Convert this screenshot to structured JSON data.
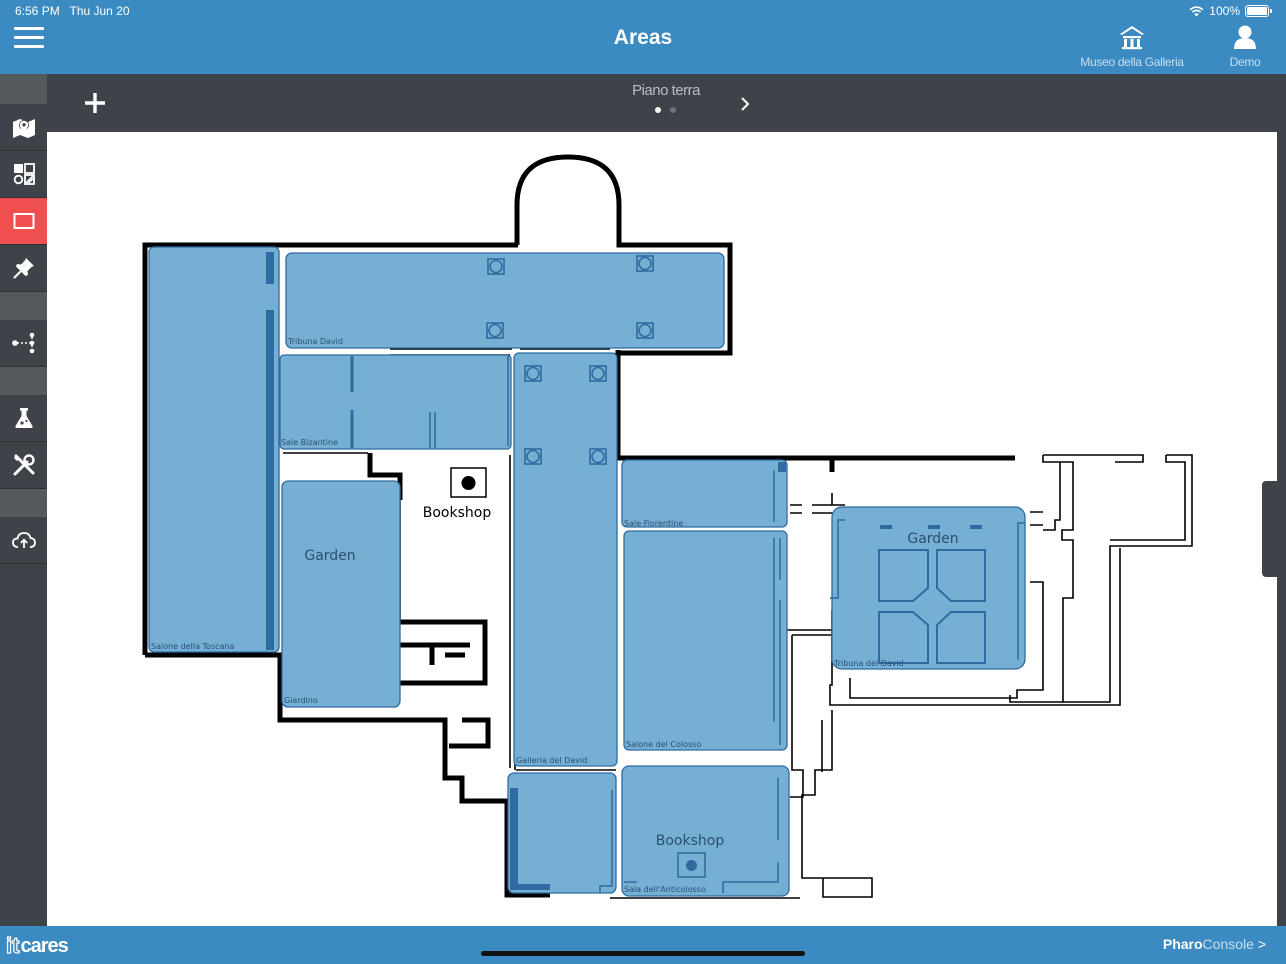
{
  "status_bar": {
    "time": "6:56 PM",
    "date": "Thu Jun 20",
    "battery": "100%"
  },
  "header": {
    "title": "Areas",
    "venue_label": "Museo della Galleria",
    "user_label": "Demo"
  },
  "floor_selector": {
    "floor_name": "Piano terra",
    "pages": 2,
    "current_page": 1
  },
  "sidebar": {
    "items": [
      {
        "icon": "map-pin-icon",
        "active": false
      },
      {
        "icon": "grid-icon",
        "active": false
      },
      {
        "icon": "rectangle-icon",
        "active": true
      },
      {
        "icon": "pushpin-icon",
        "active": false
      },
      {
        "icon": "path-nodes-icon",
        "active": false
      },
      {
        "icon": "flask-icon",
        "active": false
      },
      {
        "icon": "tools-icon",
        "active": false
      },
      {
        "icon": "cloud-upload-icon",
        "active": false
      }
    ]
  },
  "map": {
    "areas": [
      {
        "label": "Tribuna David"
      },
      {
        "label": "Sale Bizantine"
      },
      {
        "label": "Salone della Toscana"
      },
      {
        "label": "Giardino"
      },
      {
        "label": "Galleria del David"
      },
      {
        "label": "Sale Fiorentine"
      },
      {
        "label": "Salone del Colosso"
      },
      {
        "label": "Tribuna del David"
      },
      {
        "label": "Sala dell'Anticolosso"
      }
    ],
    "poi_labels": {
      "garden_left": "Garden",
      "garden_right": "Garden",
      "bookshop_top": "Bookshop",
      "bookshop_bottom": "Bookshop"
    },
    "colors": {
      "area_fill": "#76afd4",
      "area_stroke": "#2f6aa0",
      "wall": "#000000"
    }
  },
  "footer": {
    "logo_it": "it",
    "logo_cares": "cares",
    "console_bold": "Pharo",
    "console_light": "Console",
    "console_arrow": ">"
  }
}
